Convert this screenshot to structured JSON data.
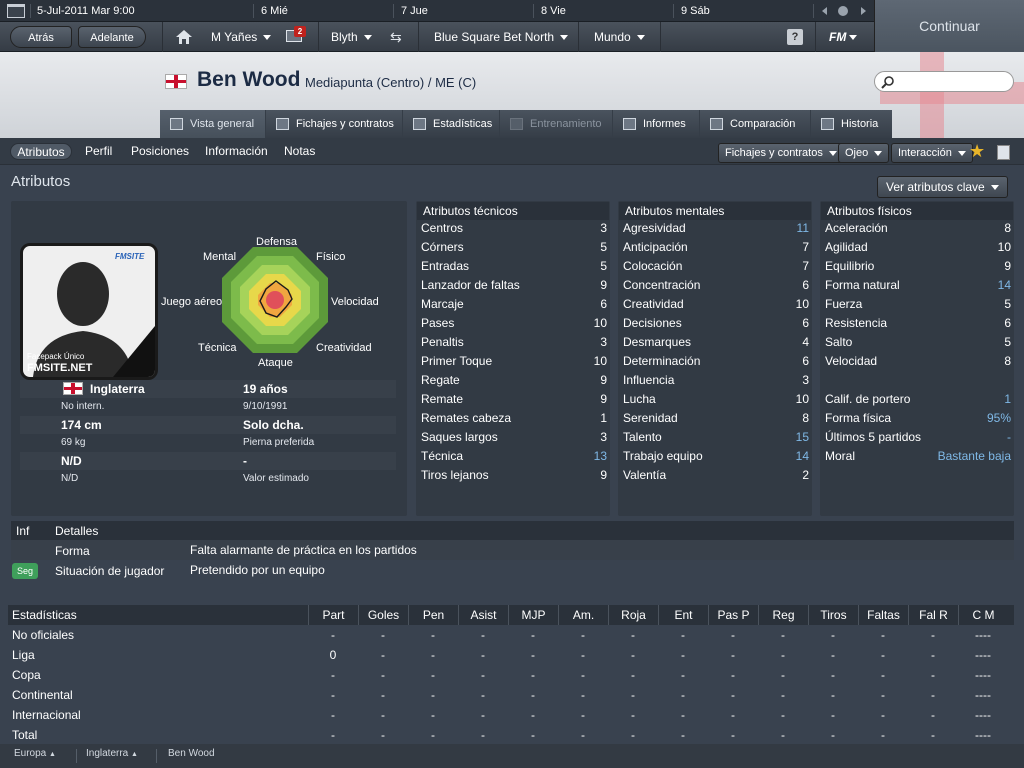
{
  "calendar": {
    "date": "5-Jul-2011",
    "day": "Mar",
    "time": "9:00",
    "days": [
      "6 Mié",
      "7 Jue",
      "8 Vie",
      "9 Sáb"
    ]
  },
  "nav": {
    "back": "Atrás",
    "forward": "Adelante",
    "manager": "M Yañes",
    "inbox_badge": "2",
    "club": "Blyth",
    "competition": "Blue Square Bet North",
    "world": "Mundo",
    "help": "?",
    "fm": "FM",
    "continue": "Continuar"
  },
  "player": {
    "name": "Ben Wood",
    "position": "Mediapunta (Centro) / ME (C)",
    "nationality": "Inglaterra",
    "intl": "No intern.",
    "age": "19 años",
    "dob": "9/10/1991",
    "height": "174 cm",
    "foot": "Solo dcha.",
    "weight": "69 kg",
    "foot_label": "Pierna preferida",
    "nd1": "N/D",
    "nd2": "N/D",
    "value": "-",
    "value_label": "Valor estimado",
    "photo_label1": "Facepack",
    "photo_label2": "Único",
    "photo_site": "FMSITE.NET",
    "photo_logo": "FMSITE"
  },
  "tabs": [
    "Vista general",
    "Fichajes y contratos",
    "Estadísticas",
    "Entrenamiento",
    "Informes",
    "Comparación",
    "Historia"
  ],
  "subtabs": [
    "Atributos",
    "Perfil",
    "Posiciones",
    "Información",
    "Notas"
  ],
  "dropdowns": {
    "contracts": "Fichajes y contratos",
    "scout": "Ojeo",
    "interaction": "Interacción",
    "key_attrs": "Ver atributos clave"
  },
  "section_title": "Atributos",
  "radar": {
    "labels": [
      "Defensa",
      "Físico",
      "Velocidad",
      "Creatividad",
      "Ataque",
      "Técnica",
      "Juego aéreo",
      "Mental"
    ],
    "colors": [
      "#5d9a3a",
      "#7dbb4b",
      "#a6d35a",
      "#e7d84a",
      "#f0a640",
      "#e0505a"
    ]
  },
  "technical": {
    "title": "Atributos técnicos",
    "items": [
      {
        "n": "Centros",
        "v": "3",
        "h": false
      },
      {
        "n": "Córners",
        "v": "5",
        "h": false
      },
      {
        "n": "Entradas",
        "v": "5",
        "h": false
      },
      {
        "n": "Lanzador de faltas",
        "v": "9",
        "h": false
      },
      {
        "n": "Marcaje",
        "v": "6",
        "h": false
      },
      {
        "n": "Pases",
        "v": "10",
        "h": false
      },
      {
        "n": "Penaltis",
        "v": "3",
        "h": false
      },
      {
        "n": "Primer Toque",
        "v": "10",
        "h": false
      },
      {
        "n": "Regate",
        "v": "9",
        "h": false
      },
      {
        "n": "Remate",
        "v": "9",
        "h": false
      },
      {
        "n": "Remates cabeza",
        "v": "1",
        "h": false
      },
      {
        "n": "Saques largos",
        "v": "3",
        "h": false
      },
      {
        "n": "Técnica",
        "v": "13",
        "h": true
      },
      {
        "n": "Tiros lejanos",
        "v": "9",
        "h": false
      }
    ]
  },
  "mental": {
    "title": "Atributos mentales",
    "items": [
      {
        "n": "Agresividad",
        "v": "11",
        "h": true
      },
      {
        "n": "Anticipación",
        "v": "7",
        "h": false
      },
      {
        "n": "Colocación",
        "v": "7",
        "h": false
      },
      {
        "n": "Concentración",
        "v": "6",
        "h": false
      },
      {
        "n": "Creatividad",
        "v": "10",
        "h": false
      },
      {
        "n": "Decisiones",
        "v": "6",
        "h": false
      },
      {
        "n": "Desmarques",
        "v": "4",
        "h": false
      },
      {
        "n": "Determinación",
        "v": "6",
        "h": false
      },
      {
        "n": "Influencia",
        "v": "3",
        "h": false
      },
      {
        "n": "Lucha",
        "v": "10",
        "h": false
      },
      {
        "n": "Serenidad",
        "v": "8",
        "h": false
      },
      {
        "n": "Talento",
        "v": "15",
        "h": true
      },
      {
        "n": "Trabajo equipo",
        "v": "14",
        "h": true
      },
      {
        "n": "Valentía",
        "v": "2",
        "h": false
      }
    ]
  },
  "physical": {
    "title": "Atributos físicos",
    "items": [
      {
        "n": "Aceleración",
        "v": "8",
        "h": false
      },
      {
        "n": "Agilidad",
        "v": "10",
        "h": false
      },
      {
        "n": "Equilibrio",
        "v": "9",
        "h": false
      },
      {
        "n": "Forma natural",
        "v": "14",
        "h": true
      },
      {
        "n": "Fuerza",
        "v": "5",
        "h": false
      },
      {
        "n": "Resistencia",
        "v": "6",
        "h": false
      },
      {
        "n": "Salto",
        "v": "5",
        "h": false
      },
      {
        "n": "Velocidad",
        "v": "8",
        "h": false
      }
    ],
    "extra": [
      {
        "n": "Calif. de portero",
        "v": "1",
        "h": true
      },
      {
        "n": "Forma física",
        "v": "95%",
        "h": true
      },
      {
        "n": "Últimos 5 partidos",
        "v": "-",
        "h": true
      },
      {
        "n": "Moral",
        "v": "Bastante baja",
        "h": true
      }
    ]
  },
  "details": {
    "col1": "Inf",
    "col2": "Detalles",
    "rows": [
      {
        "badge": "",
        "label": "Forma",
        "text": "Falta alarmante de práctica en los partidos"
      },
      {
        "badge": "Seg",
        "label": "Situación de jugador",
        "text": "Pretendido por un equipo"
      }
    ]
  },
  "stats": {
    "title": "Estadísticas",
    "headers": [
      "Part",
      "Goles",
      "Pen",
      "Asist",
      "MJP",
      "Am.",
      "Roja",
      "Ent",
      "Pas P",
      "Reg",
      "Tiros",
      "Faltas",
      "Fal R",
      "C M"
    ],
    "rows": [
      {
        "label": "No oficiales",
        "vals": [
          "-",
          "-",
          "-",
          "-",
          "-",
          "-",
          "-",
          "-",
          "-",
          "-",
          "-",
          "-",
          "-",
          "----"
        ]
      },
      {
        "label": "Liga",
        "vals": [
          "0",
          "-",
          "-",
          "-",
          "-",
          "-",
          "-",
          "-",
          "-",
          "-",
          "-",
          "-",
          "-",
          "----"
        ]
      },
      {
        "label": "Copa",
        "vals": [
          "-",
          "-",
          "-",
          "-",
          "-",
          "-",
          "-",
          "-",
          "-",
          "-",
          "-",
          "-",
          "-",
          "----"
        ]
      },
      {
        "label": "Continental",
        "vals": [
          "-",
          "-",
          "-",
          "-",
          "-",
          "-",
          "-",
          "-",
          "-",
          "-",
          "-",
          "-",
          "-",
          "----"
        ]
      },
      {
        "label": "Internacional",
        "vals": [
          "-",
          "-",
          "-",
          "-",
          "-",
          "-",
          "-",
          "-",
          "-",
          "-",
          "-",
          "-",
          "-",
          "----"
        ]
      },
      {
        "label": "Total",
        "vals": [
          "-",
          "-",
          "-",
          "-",
          "-",
          "-",
          "-",
          "-",
          "-",
          "-",
          "-",
          "-",
          "-",
          "----"
        ]
      }
    ]
  },
  "breadcrumb": [
    "Europa",
    "Inglaterra",
    "Ben Wood"
  ]
}
